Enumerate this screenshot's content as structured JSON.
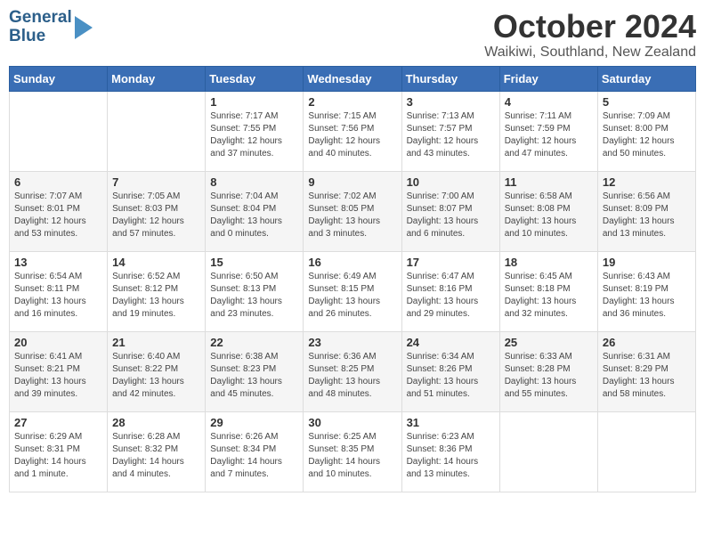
{
  "header": {
    "logo_line1": "General",
    "logo_line2": "Blue",
    "month": "October 2024",
    "location": "Waikiwi, Southland, New Zealand"
  },
  "weekdays": [
    "Sunday",
    "Monday",
    "Tuesday",
    "Wednesday",
    "Thursday",
    "Friday",
    "Saturday"
  ],
  "weeks": [
    [
      {
        "day": "",
        "info": ""
      },
      {
        "day": "",
        "info": ""
      },
      {
        "day": "1",
        "info": "Sunrise: 7:17 AM\nSunset: 7:55 PM\nDaylight: 12 hours\nand 37 minutes."
      },
      {
        "day": "2",
        "info": "Sunrise: 7:15 AM\nSunset: 7:56 PM\nDaylight: 12 hours\nand 40 minutes."
      },
      {
        "day": "3",
        "info": "Sunrise: 7:13 AM\nSunset: 7:57 PM\nDaylight: 12 hours\nand 43 minutes."
      },
      {
        "day": "4",
        "info": "Sunrise: 7:11 AM\nSunset: 7:59 PM\nDaylight: 12 hours\nand 47 minutes."
      },
      {
        "day": "5",
        "info": "Sunrise: 7:09 AM\nSunset: 8:00 PM\nDaylight: 12 hours\nand 50 minutes."
      }
    ],
    [
      {
        "day": "6",
        "info": "Sunrise: 7:07 AM\nSunset: 8:01 PM\nDaylight: 12 hours\nand 53 minutes."
      },
      {
        "day": "7",
        "info": "Sunrise: 7:05 AM\nSunset: 8:03 PM\nDaylight: 12 hours\nand 57 minutes."
      },
      {
        "day": "8",
        "info": "Sunrise: 7:04 AM\nSunset: 8:04 PM\nDaylight: 13 hours\nand 0 minutes."
      },
      {
        "day": "9",
        "info": "Sunrise: 7:02 AM\nSunset: 8:05 PM\nDaylight: 13 hours\nand 3 minutes."
      },
      {
        "day": "10",
        "info": "Sunrise: 7:00 AM\nSunset: 8:07 PM\nDaylight: 13 hours\nand 6 minutes."
      },
      {
        "day": "11",
        "info": "Sunrise: 6:58 AM\nSunset: 8:08 PM\nDaylight: 13 hours\nand 10 minutes."
      },
      {
        "day": "12",
        "info": "Sunrise: 6:56 AM\nSunset: 8:09 PM\nDaylight: 13 hours\nand 13 minutes."
      }
    ],
    [
      {
        "day": "13",
        "info": "Sunrise: 6:54 AM\nSunset: 8:11 PM\nDaylight: 13 hours\nand 16 minutes."
      },
      {
        "day": "14",
        "info": "Sunrise: 6:52 AM\nSunset: 8:12 PM\nDaylight: 13 hours\nand 19 minutes."
      },
      {
        "day": "15",
        "info": "Sunrise: 6:50 AM\nSunset: 8:13 PM\nDaylight: 13 hours\nand 23 minutes."
      },
      {
        "day": "16",
        "info": "Sunrise: 6:49 AM\nSunset: 8:15 PM\nDaylight: 13 hours\nand 26 minutes."
      },
      {
        "day": "17",
        "info": "Sunrise: 6:47 AM\nSunset: 8:16 PM\nDaylight: 13 hours\nand 29 minutes."
      },
      {
        "day": "18",
        "info": "Sunrise: 6:45 AM\nSunset: 8:18 PM\nDaylight: 13 hours\nand 32 minutes."
      },
      {
        "day": "19",
        "info": "Sunrise: 6:43 AM\nSunset: 8:19 PM\nDaylight: 13 hours\nand 36 minutes."
      }
    ],
    [
      {
        "day": "20",
        "info": "Sunrise: 6:41 AM\nSunset: 8:21 PM\nDaylight: 13 hours\nand 39 minutes."
      },
      {
        "day": "21",
        "info": "Sunrise: 6:40 AM\nSunset: 8:22 PM\nDaylight: 13 hours\nand 42 minutes."
      },
      {
        "day": "22",
        "info": "Sunrise: 6:38 AM\nSunset: 8:23 PM\nDaylight: 13 hours\nand 45 minutes."
      },
      {
        "day": "23",
        "info": "Sunrise: 6:36 AM\nSunset: 8:25 PM\nDaylight: 13 hours\nand 48 minutes."
      },
      {
        "day": "24",
        "info": "Sunrise: 6:34 AM\nSunset: 8:26 PM\nDaylight: 13 hours\nand 51 minutes."
      },
      {
        "day": "25",
        "info": "Sunrise: 6:33 AM\nSunset: 8:28 PM\nDaylight: 13 hours\nand 55 minutes."
      },
      {
        "day": "26",
        "info": "Sunrise: 6:31 AM\nSunset: 8:29 PM\nDaylight: 13 hours\nand 58 minutes."
      }
    ],
    [
      {
        "day": "27",
        "info": "Sunrise: 6:29 AM\nSunset: 8:31 PM\nDaylight: 14 hours\nand 1 minute."
      },
      {
        "day": "28",
        "info": "Sunrise: 6:28 AM\nSunset: 8:32 PM\nDaylight: 14 hours\nand 4 minutes."
      },
      {
        "day": "29",
        "info": "Sunrise: 6:26 AM\nSunset: 8:34 PM\nDaylight: 14 hours\nand 7 minutes."
      },
      {
        "day": "30",
        "info": "Sunrise: 6:25 AM\nSunset: 8:35 PM\nDaylight: 14 hours\nand 10 minutes."
      },
      {
        "day": "31",
        "info": "Sunrise: 6:23 AM\nSunset: 8:36 PM\nDaylight: 14 hours\nand 13 minutes."
      },
      {
        "day": "",
        "info": ""
      },
      {
        "day": "",
        "info": ""
      }
    ]
  ]
}
